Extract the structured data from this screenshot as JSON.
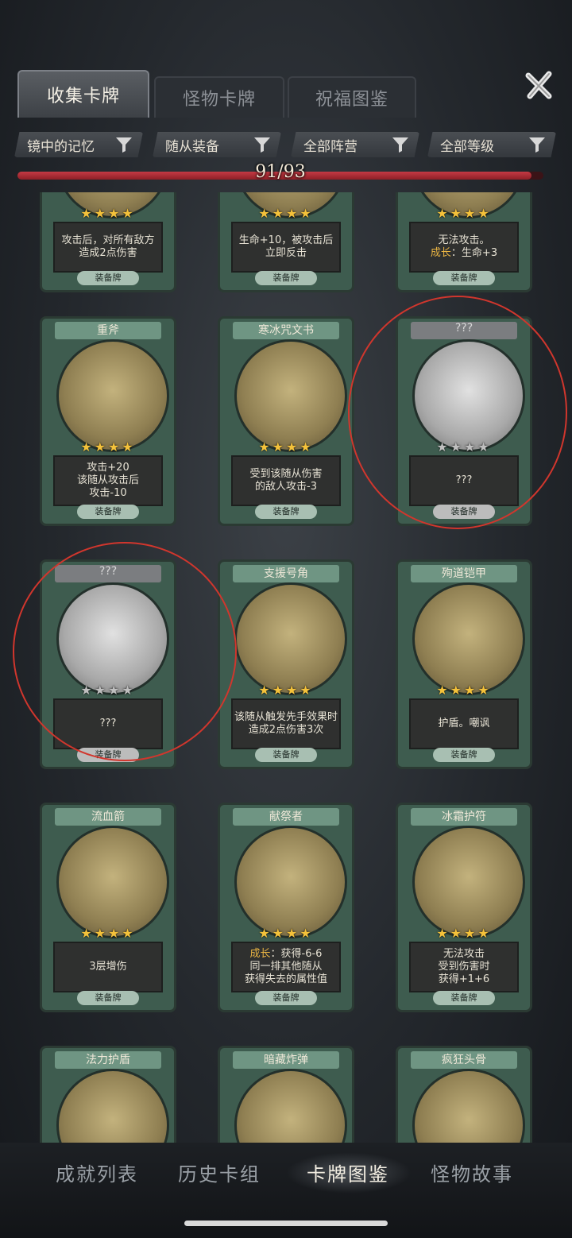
{
  "tabs": [
    "收集卡牌",
    "怪物卡牌",
    "祝福图鉴"
  ],
  "filters": [
    "镜中的记忆",
    "随从装备",
    "全部阵营",
    "全部等级"
  ],
  "progress": {
    "text": "91/93",
    "value": 0.978
  },
  "stars": "★★★★",
  "cards": [
    {
      "title": "",
      "desc": [
        "攻击后，对所有敌方",
        "造成2点伤害"
      ],
      "footer": "装备牌",
      "locked": false
    },
    {
      "title": "",
      "desc": [
        "生命+10，被攻击后",
        "立即反击"
      ],
      "footer": "装备牌",
      "locked": false
    },
    {
      "title": "",
      "desc": [
        "无法攻击。",
        "成长：生命+3"
      ],
      "hl_prefix": "成长",
      "footer": "装备牌",
      "locked": false
    },
    {
      "title": "重斧",
      "desc": [
        "攻击+20",
        "该随从攻击后",
        "攻击-10"
      ],
      "footer": "装备牌",
      "locked": false
    },
    {
      "title": "寒冰咒文书",
      "desc": [
        "受到该随从伤害",
        "的敌人攻击-3"
      ],
      "footer": "装备牌",
      "locked": false
    },
    {
      "title": "???",
      "desc": [
        "???"
      ],
      "footer": "装备牌",
      "locked": true
    },
    {
      "title": "???",
      "desc": [
        "???"
      ],
      "footer": "装备牌",
      "locked": true
    },
    {
      "title": "支援号角",
      "desc": [
        "该随从触发先手效果时",
        "造成2点伤害3次"
      ],
      "footer": "装备牌",
      "locked": false
    },
    {
      "title": "殉道铠甲",
      "desc": [
        "护盾。嘲讽"
      ],
      "footer": "装备牌",
      "locked": false
    },
    {
      "title": "流血箭",
      "desc": [
        "3层增伤"
      ],
      "footer": "装备牌",
      "locked": false
    },
    {
      "title": "献祭者",
      "desc": [
        "成长：获得-6-6",
        "同一排其他随从",
        "获得失去的属性值"
      ],
      "footer": "装备牌",
      "locked": false
    },
    {
      "title": "冰霜护符",
      "desc": [
        "无法攻击",
        "受到伤害时",
        "获得+1+6"
      ],
      "footer": "装备牌",
      "locked": false
    },
    {
      "title": "法力护盾",
      "desc": [],
      "footer": "",
      "locked": false
    },
    {
      "title": "暗藏炸弹",
      "desc": [],
      "footer": "",
      "locked": false
    },
    {
      "title": "疯狂头骨",
      "desc": [],
      "footer": "",
      "locked": false
    }
  ],
  "bottom_nav": [
    "成就列表",
    "历史卡组",
    "卡牌图鉴",
    "怪物故事"
  ],
  "colors": {
    "accent_red": "#c53a44",
    "card_green": "#3e5c4f",
    "star": "#f4c23b",
    "annotation": "#d1362d"
  }
}
